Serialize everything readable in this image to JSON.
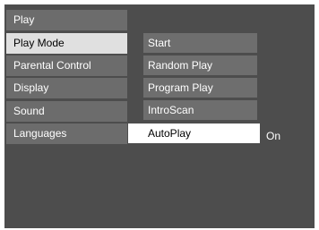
{
  "left_menu": {
    "items": [
      {
        "label": "Play"
      },
      {
        "label": "Play Mode"
      },
      {
        "label": "Parental Control"
      },
      {
        "label": "Display"
      },
      {
        "label": "Sound"
      },
      {
        "label": "Languages"
      }
    ],
    "selected_index": 1
  },
  "submenu": {
    "items": [
      {
        "label": "Start"
      },
      {
        "label": "Random Play"
      },
      {
        "label": "Program Play"
      },
      {
        "label": "IntroScan"
      },
      {
        "label": "AutoPlay"
      }
    ],
    "selected_index": 4
  },
  "autoplay_value": "On",
  "colors": {
    "screen_bg": "#4d4d4d",
    "item_bg": "#6c6c6c",
    "left_selected_bg": "#e0e0e0",
    "right_selected_bg": "#ffffff",
    "text": "#ffffff",
    "selected_text": "#000000"
  }
}
